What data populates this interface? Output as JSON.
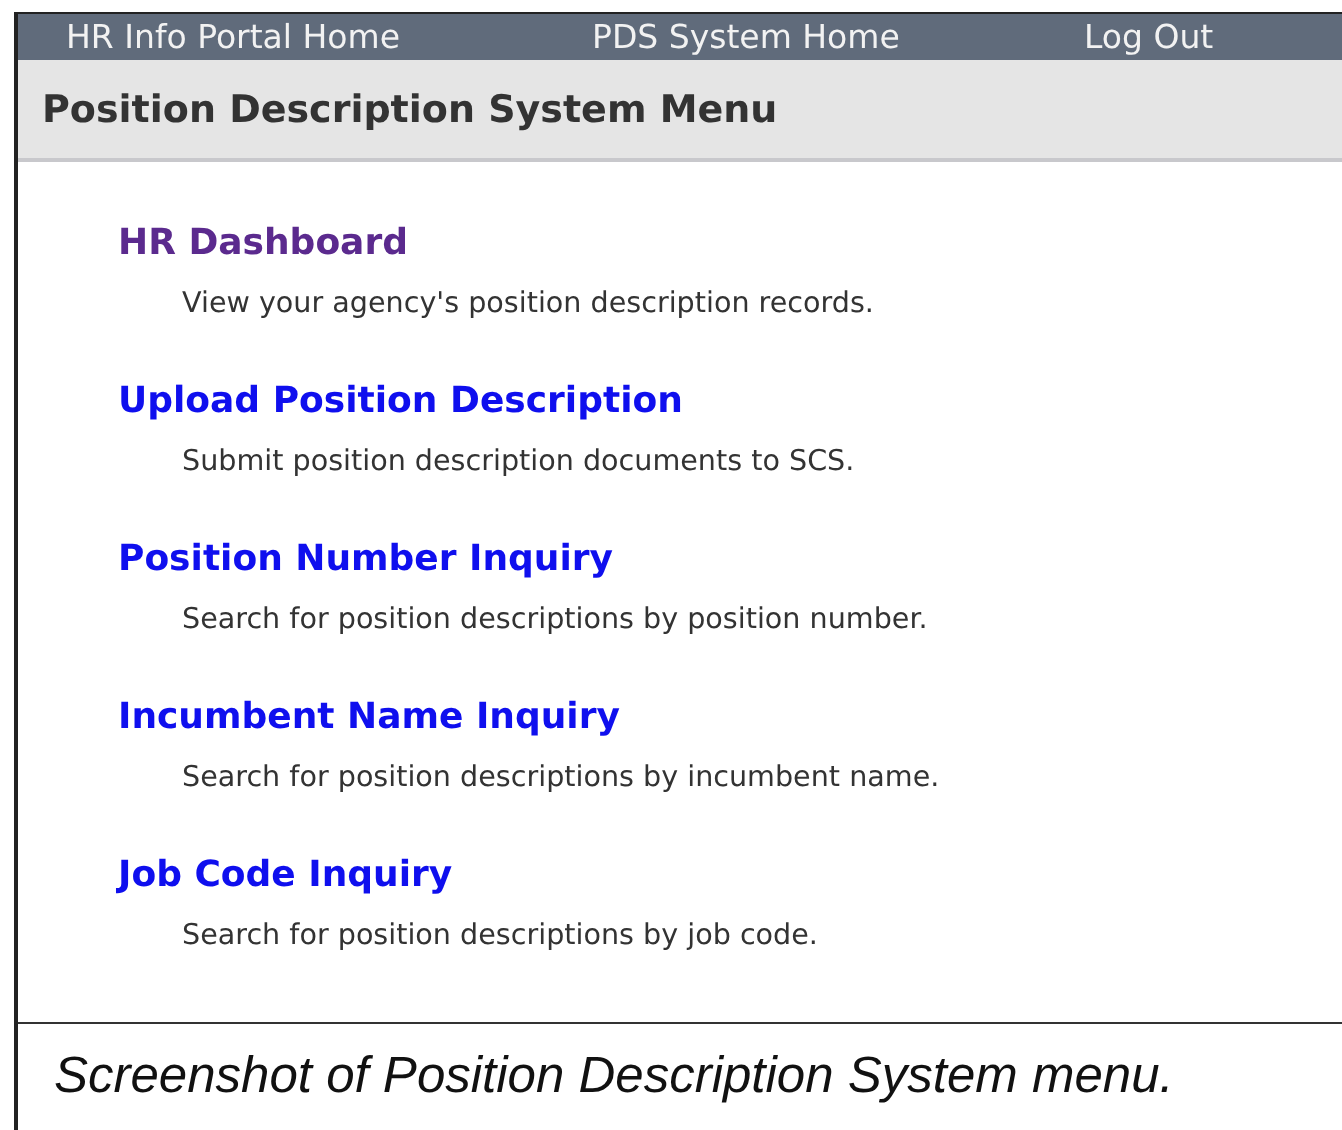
{
  "nav": [
    {
      "label": "HR Info Portal Home"
    },
    {
      "label": "PDS System Home"
    },
    {
      "label": "Log Out"
    }
  ],
  "page_title": "Position Description System Menu",
  "menu": [
    {
      "label": "HR Dashboard",
      "visited": true,
      "description": "View your agency's position description records."
    },
    {
      "label": "Upload Position Description",
      "visited": false,
      "description": "Submit position description documents to SCS."
    },
    {
      "label": "Position Number Inquiry",
      "visited": false,
      "description": "Search for position descriptions by position number."
    },
    {
      "label": "Incumbent Name Inquiry",
      "visited": false,
      "description": "Search for position descriptions by incumbent name."
    },
    {
      "label": "Job Code Inquiry",
      "visited": false,
      "description": "Search for position descriptions by job code."
    }
  ],
  "caption": "Screenshot of Position Description System menu."
}
